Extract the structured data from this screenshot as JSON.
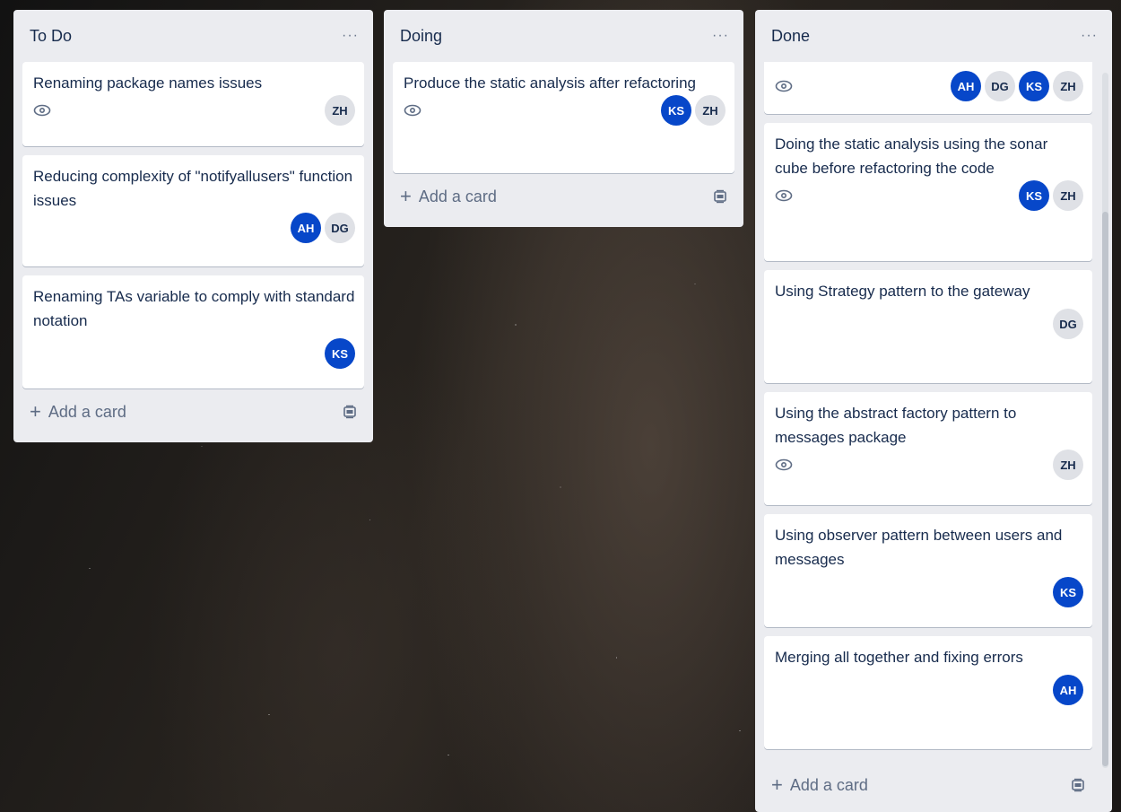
{
  "lists": [
    {
      "title": "To Do",
      "menu": "···",
      "add_label": "Add a card",
      "cards": [
        {
          "title": "Renaming package names issues",
          "watch": true,
          "members": [
            "ZH"
          ]
        },
        {
          "title": "Reducing complexity of \"notifyallusers\" function issues",
          "watch": false,
          "members": [
            "AH",
            "DG"
          ]
        },
        {
          "title": "Renaming TAs variable to comply with standard notation",
          "watch": false,
          "members": [
            "KS"
          ]
        }
      ]
    },
    {
      "title": "Doing",
      "menu": "···",
      "add_label": "Add a card",
      "cards": [
        {
          "title": "Produce the static analysis after refactoring",
          "watch": true,
          "members": [
            "KS",
            "ZH"
          ]
        }
      ]
    },
    {
      "title": "Done",
      "menu": "···",
      "add_label": "Add a card",
      "cards": [
        {
          "title": "",
          "watch": true,
          "members": [
            "AH",
            "DG",
            "KS",
            "ZH"
          ]
        },
        {
          "title": "Doing the static analysis using the sonar cube before refactoring the code",
          "watch": true,
          "members": [
            "KS",
            "ZH"
          ]
        },
        {
          "title": "Using Strategy pattern to the gateway",
          "watch": false,
          "members": [
            "DG"
          ]
        },
        {
          "title": "Using the abstract factory pattern to messages package",
          "watch": true,
          "members": [
            "ZH"
          ]
        },
        {
          "title": "Using observer pattern between users and messages",
          "watch": false,
          "members": [
            "KS"
          ]
        },
        {
          "title": "Merging all together and fixing errors",
          "watch": false,
          "members": [
            "AH"
          ]
        }
      ]
    }
  ],
  "member_colors": {
    "AH": "blue",
    "KS": "blue",
    "DG": "gray",
    "ZH": "gray"
  },
  "icons": {
    "watch": "eye-icon",
    "template": "card-template-icon",
    "add": "plus-icon"
  }
}
